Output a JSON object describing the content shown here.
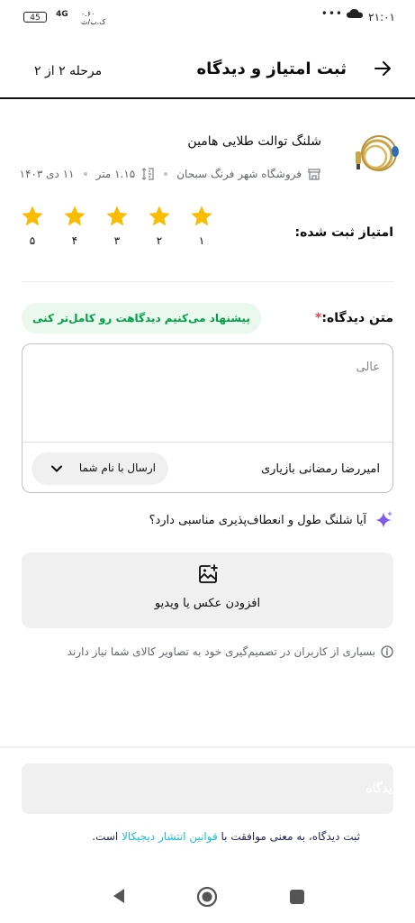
{
  "status_bar": {
    "time": "۲۱:۰۱",
    "dots": "•••",
    "battery": "45",
    "network": "4G",
    "speed_value": "۰.۶۰",
    "speed_unit": "ک.ب/ث"
  },
  "header": {
    "title": "ثبت امتیاز و دیدگاه",
    "step": "مرحله ۲ از ۲"
  },
  "product": {
    "name": "شلنگ توالت طلایی هامین",
    "seller": "فروشگاه شهر فرنگ سبحان",
    "size": "۱.۱۵ متر",
    "date": "۱۱ دی ۱۴۰۳"
  },
  "rating": {
    "label": "امتیاز ثبت شده:",
    "stars": [
      "۱",
      "۲",
      "۳",
      "۴",
      "۵"
    ],
    "value": 5,
    "star_color": "#f9bc00"
  },
  "review": {
    "label": "متن دیدگاه:",
    "required_mark": "*",
    "hint": "پیشنهاد می‌کنیم دیدگاهت رو کامل‌تر کنی",
    "text": "عالی",
    "author": "امیررضا رمضانی بازیاری",
    "send_as": "ارسال با نام شما"
  },
  "question": {
    "text": "آیا شلنگ طول و انعطاف‌پذیری مناسبی دارد؟"
  },
  "media": {
    "add_label": "افزودن عکس یا ویدیو",
    "info": "بسیاری از کاربران در تصمیم‌گیری خود به تصاویر کالای شما نیاز دارند"
  },
  "submit": {
    "label": "ثبت دیدگاه"
  },
  "terms": {
    "prefix": "ثبت دیدگاه، به معنی موافقت با ",
    "link": "قوانین انتشار دیجیکالا",
    "suffix": " است."
  },
  "colors": {
    "primary_text": "#0c0c0c",
    "secondary_text": "#62666d",
    "required": "#ef394e",
    "success": "#00a049",
    "link": "#19bfd3"
  }
}
